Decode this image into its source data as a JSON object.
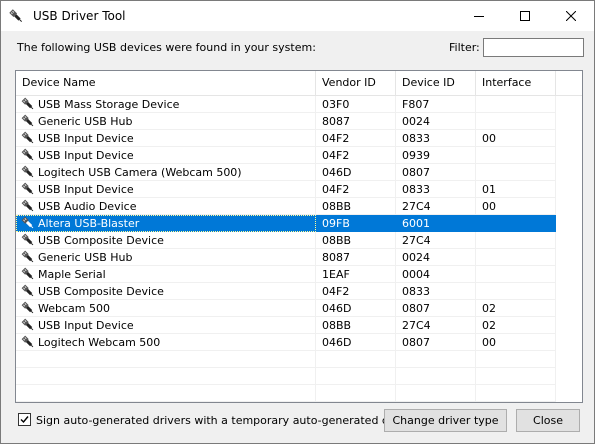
{
  "window": {
    "title": "USB Driver Tool"
  },
  "header": {
    "found_label": "The following USB devices were found in your system:",
    "filter_label": "Filter:",
    "filter_value": "",
    "filter_placeholder": ""
  },
  "table": {
    "columns": [
      "Device Name",
      "Vendor ID",
      "Device ID",
      "Interface"
    ],
    "rows": [
      {
        "name": "USB Mass Storage Device",
        "vendor": "03F0",
        "device": "F807",
        "iface": ""
      },
      {
        "name": "Generic USB Hub",
        "vendor": "8087",
        "device": "0024",
        "iface": ""
      },
      {
        "name": "USB Input Device",
        "vendor": "04F2",
        "device": "0833",
        "iface": "00"
      },
      {
        "name": "USB Input Device",
        "vendor": "04F2",
        "device": "0939",
        "iface": ""
      },
      {
        "name": "Logitech USB Camera (Webcam 500)",
        "vendor": "046D",
        "device": "0807",
        "iface": ""
      },
      {
        "name": "USB Input Device",
        "vendor": "04F2",
        "device": "0833",
        "iface": "01"
      },
      {
        "name": "USB Audio Device",
        "vendor": "08BB",
        "device": "27C4",
        "iface": "00"
      },
      {
        "name": "Altera USB-Blaster",
        "vendor": "09FB",
        "device": "6001",
        "iface": "",
        "selected": true
      },
      {
        "name": "USB Composite Device",
        "vendor": "08BB",
        "device": "27C4",
        "iface": ""
      },
      {
        "name": "Generic USB Hub",
        "vendor": "8087",
        "device": "0024",
        "iface": ""
      },
      {
        "name": "Maple Serial",
        "vendor": "1EAF",
        "device": "0004",
        "iface": ""
      },
      {
        "name": "USB Composite Device",
        "vendor": "04F2",
        "device": "0833",
        "iface": ""
      },
      {
        "name": "Webcam 500",
        "vendor": "046D",
        "device": "0807",
        "iface": "02"
      },
      {
        "name": "USB Input Device",
        "vendor": "08BB",
        "device": "27C4",
        "iface": "02"
      },
      {
        "name": "Logitech Webcam 500",
        "vendor": "046D",
        "device": "0807",
        "iface": "00"
      }
    ],
    "row_icon": "usb-plug-icon"
  },
  "footer": {
    "sign_checkbox_label": "Sign auto-generated drivers with a temporary auto-generated certificate",
    "sign_checked": true,
    "change_driver_label": "Change driver type",
    "close_label": "Close"
  },
  "colors": {
    "selection": "#0078d7",
    "window_bg": "#f0f0f0"
  }
}
